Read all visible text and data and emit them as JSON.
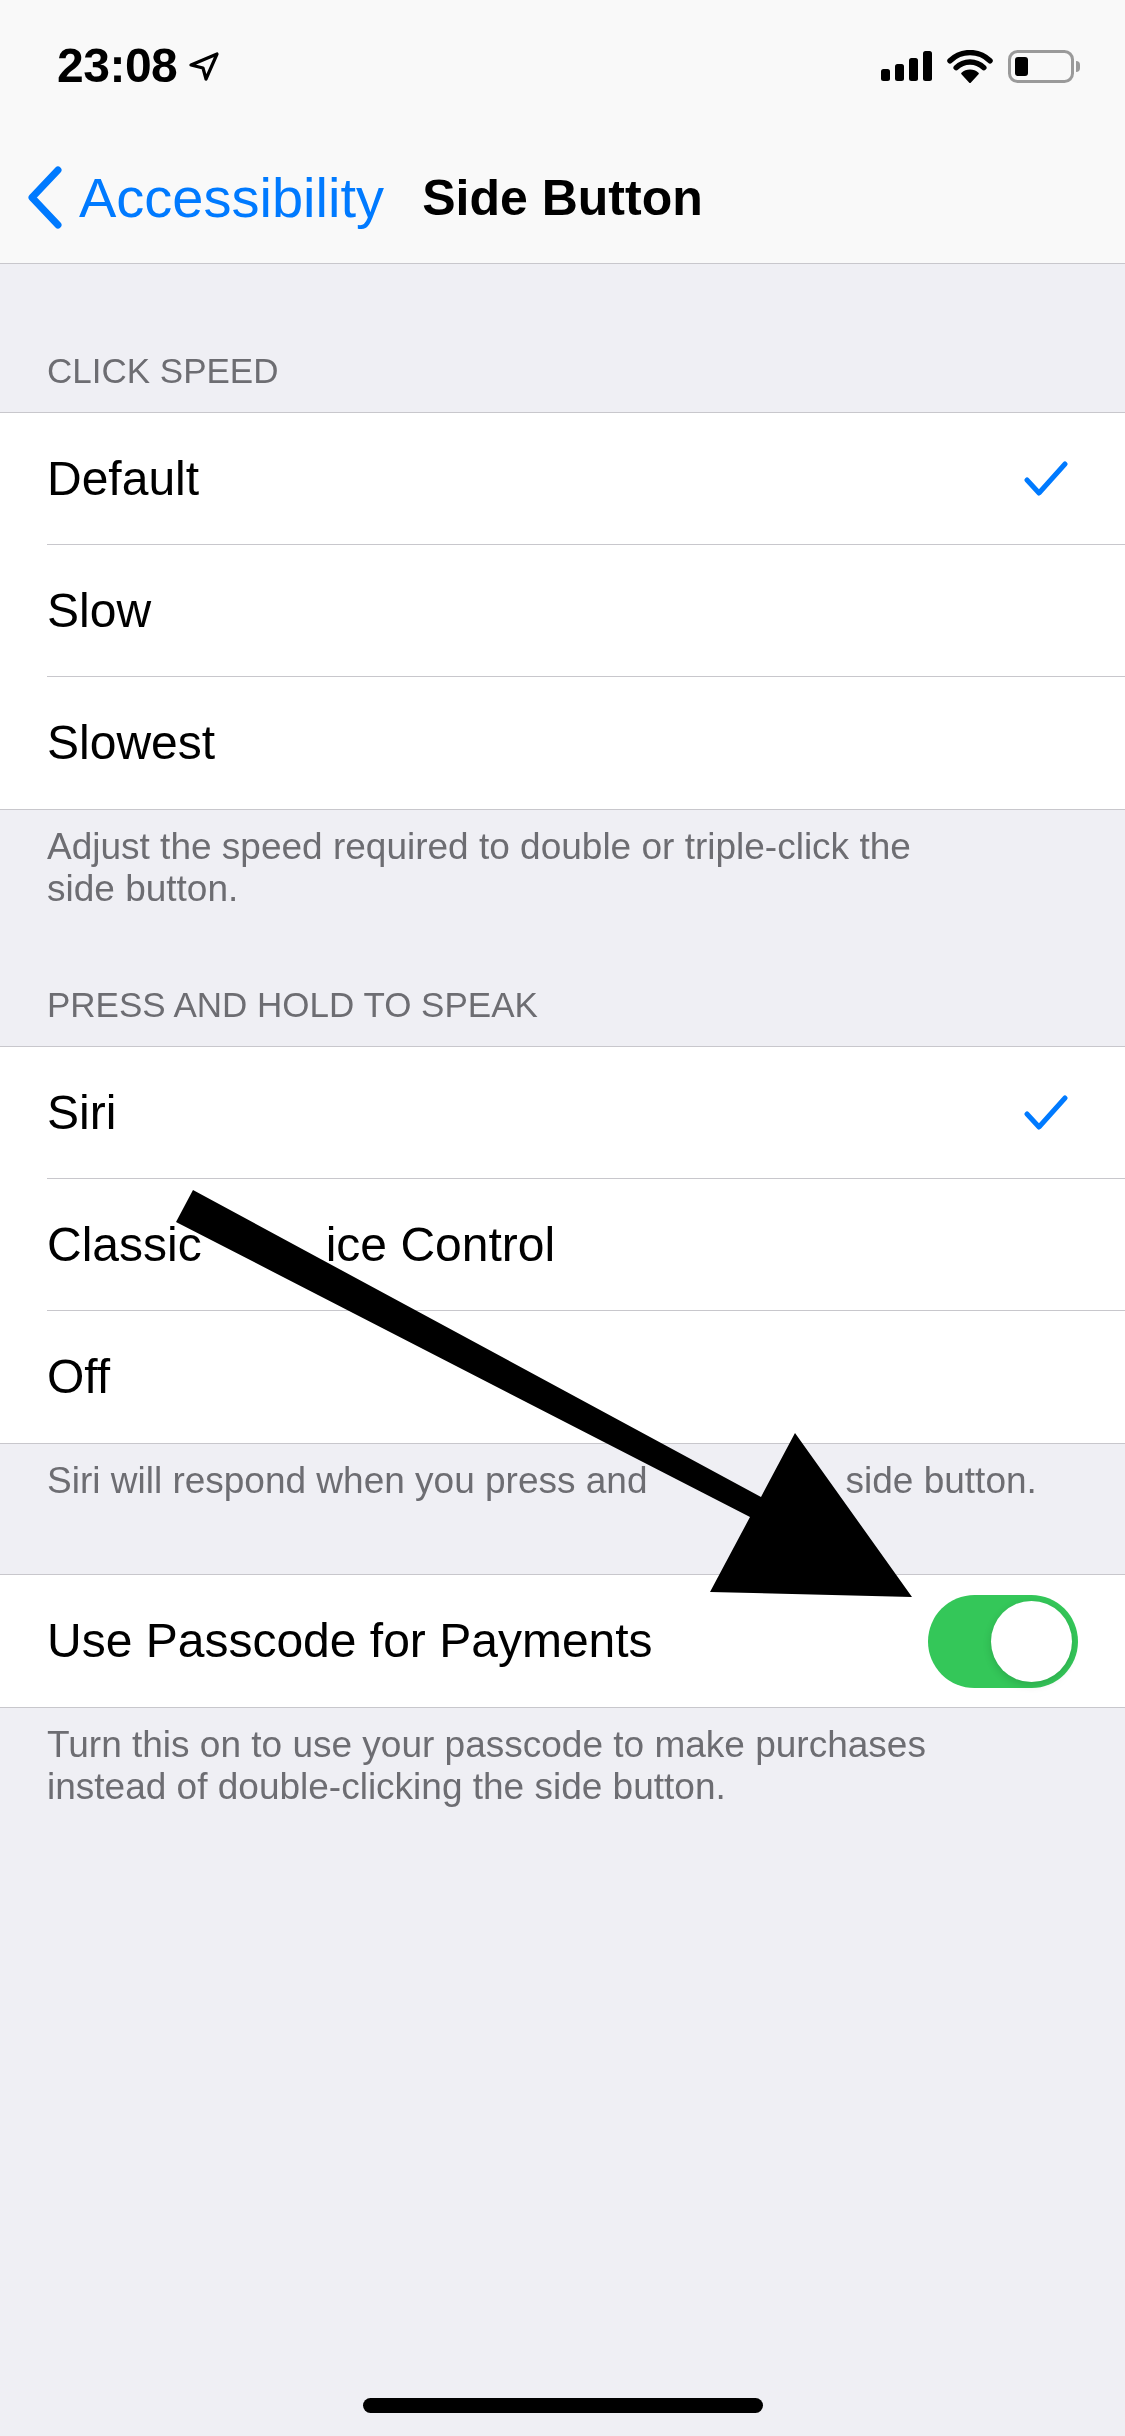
{
  "status_bar": {
    "time": "23:08"
  },
  "nav_bar": {
    "back_label": "Accessibility",
    "title": "Side Button"
  },
  "sections": [
    {
      "kind": "options",
      "header": "CLICK SPEED",
      "items": [
        {
          "label": "Default",
          "selected": true
        },
        {
          "label": "Slow",
          "selected": false
        },
        {
          "label": "Slowest",
          "selected": false
        }
      ],
      "footer": "Adjust the speed required to double or triple-click the side button."
    },
    {
      "kind": "options",
      "header": "PRESS AND HOLD TO SPEAK",
      "items": [
        {
          "label": "Siri",
          "selected": true
        },
        {
          "label_parts": [
            "Classic",
            "ice Control"
          ],
          "selected": false
        },
        {
          "label": "Off",
          "selected": false
        }
      ],
      "footer_parts": [
        "Siri will respond when you press and",
        "side button."
      ]
    },
    {
      "kind": "toggle",
      "items": [
        {
          "label": "Use Passcode for Payments",
          "on": true
        }
      ],
      "footer": "Turn this on to use your passcode to make purchases instead of double-clicking the side button."
    }
  ]
}
